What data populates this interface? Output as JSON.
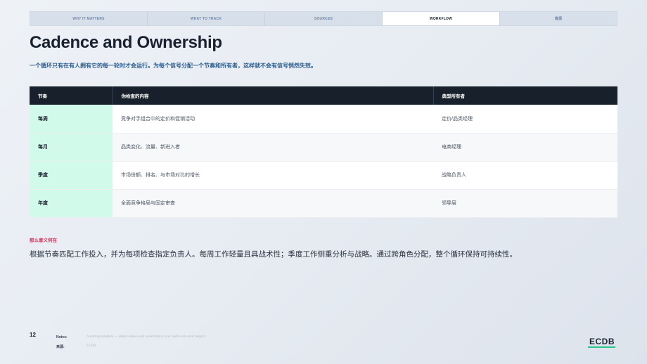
{
  "nav": {
    "tabs": [
      {
        "label": "WHY IT MATTERS",
        "active": false
      },
      {
        "label": "WHAT TO TRACK",
        "active": false
      },
      {
        "label": "SOURCES",
        "active": false
      },
      {
        "label": "WORKFLOW",
        "active": true
      },
      {
        "label": "資源",
        "active": false
      }
    ]
  },
  "page": {
    "title": "Cadence and Ownership",
    "subtitle": "一个循环只有在有人拥有它的每一轮时才会运行。为每个信号分配一个节奏和所有者，这样就不会有信号悄然失效。"
  },
  "table": {
    "headers": [
      "节奏",
      "你检查的内容",
      "典型所有者"
    ],
    "rows": [
      {
        "cadence": "每周",
        "content": "竞争对手组合中的定价和促销活动",
        "owner": "定价/品类经理"
      },
      {
        "cadence": "每月",
        "content": "品类变化、流量、新进入者",
        "owner": "电商经理"
      },
      {
        "cadence": "季度",
        "content": "市场份额、排名、与市场对比的增长",
        "owner": "战略负责人"
      },
      {
        "cadence": "年度",
        "content": "全面竞争格局与固定审查",
        "owner": "领导层"
      }
    ]
  },
  "so_what": {
    "label": "那么意义何在",
    "text": "根据节奏匹配工作投入，并为每项检查指定负责人。每周工作轻量且具战术性；季度工作侧重分析与战略。通过跨角色分配，整个循环保持可持续性。"
  },
  "footer": {
    "page_number": "12",
    "notes_label": "Notes:",
    "notes_text": "A starting template — adapt cadence and ownership to your team's size and category.",
    "source_label": "来源:",
    "source_text": "ECDB",
    "logo_text": "ECDB"
  },
  "colors": {
    "accent_green": "#2bc48a",
    "cadence_cell": "#d2faea",
    "header_dark": "#18202b",
    "subtitle_blue": "#2d5e8f",
    "label_red": "#d6345c"
  }
}
